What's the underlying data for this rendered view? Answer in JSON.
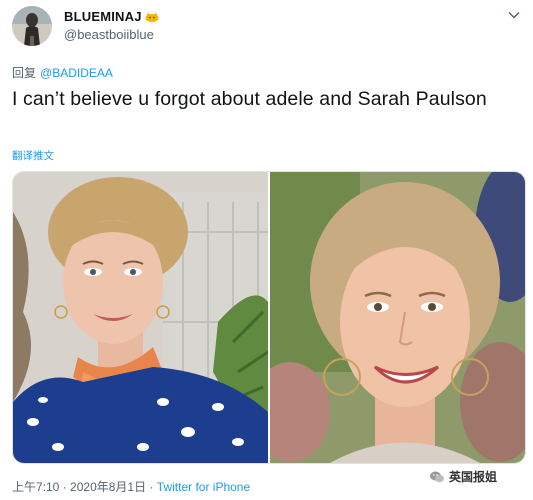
{
  "tweet": {
    "display_name": "BLUEMINAJ",
    "handle": "@beastboiiblue",
    "reply_label": "回复",
    "reply_mention": "@BADIDEAA",
    "text": "I can’t believe u forgot about adele and Sarah Paulson",
    "translate_label": "翻译推文",
    "time": "上午7:10",
    "separator": "·",
    "date": "2020年8月1日",
    "source": "Twitter for iPhone"
  },
  "watermark": {
    "text": "英国报姐"
  },
  "icons": {
    "name_badge": "cat-emoji-icon",
    "more": "chevron-down-icon",
    "watermark": "wechat-logo-icon"
  },
  "colors": {
    "link": "#1d9bf0",
    "secondary": "#536471",
    "primary": "#0f1419"
  }
}
